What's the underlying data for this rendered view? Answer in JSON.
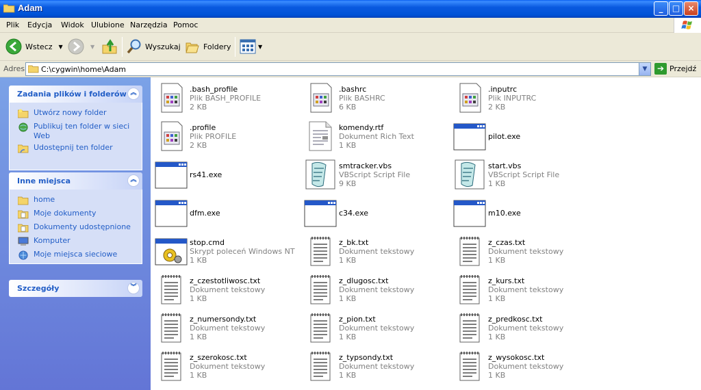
{
  "window": {
    "title": "Adam",
    "min": "_",
    "max": "□",
    "close": "×"
  },
  "menu": [
    "Plik",
    "Edycja",
    "Widok",
    "Ulubione",
    "Narzędzia",
    "Pomoc"
  ],
  "toolbar": {
    "back": "Wstecz",
    "search": "Wyszukaj",
    "folders": "Foldery"
  },
  "address": {
    "label": "Adres",
    "value": "C:\\cygwin\\home\\Adam",
    "go": "Przejdź"
  },
  "panels": {
    "tasks": {
      "title": "Zadania plików i folderów",
      "items": [
        "Utwórz nowy folder",
        "Publikuj ten folder w sieci Web",
        "Udostępnij ten folder"
      ]
    },
    "places": {
      "title": "Inne miejsca",
      "items": [
        "home",
        "Moje dokumenty",
        "Dokumenty udostępnione",
        "Komputer",
        "Moje miejsca sieciowe"
      ]
    },
    "details": {
      "title": "Szczegóły"
    }
  },
  "files": [
    {
      "name": ".bash_profile",
      "type": "Plik BASH_PROFILE",
      "size": "2 KB",
      "icon": "generic"
    },
    {
      "name": ".bashrc",
      "type": "Plik BASHRC",
      "size": "6 KB",
      "icon": "generic"
    },
    {
      "name": ".inputrc",
      "type": "Plik INPUTRC",
      "size": "2 KB",
      "icon": "generic"
    },
    {
      "name": ".profile",
      "type": "Plik PROFILE",
      "size": "2 KB",
      "icon": "generic"
    },
    {
      "name": "komendy.rtf",
      "type": "Dokument Rich Text",
      "size": "1 KB",
      "icon": "rtf"
    },
    {
      "name": "pilot.exe",
      "type": "",
      "size": "",
      "icon": "exe"
    },
    {
      "name": "rs41.exe",
      "type": "",
      "size": "",
      "icon": "exe"
    },
    {
      "name": "smtracker.vbs",
      "type": "VBScript Script File",
      "size": "9 KB",
      "icon": "vbs"
    },
    {
      "name": "start.vbs",
      "type": "VBScript Script File",
      "size": "1 KB",
      "icon": "vbs"
    },
    {
      "name": "dfm.exe",
      "type": "",
      "size": "",
      "icon": "exe"
    },
    {
      "name": "c34.exe",
      "type": "",
      "size": "",
      "icon": "exe"
    },
    {
      "name": "m10.exe",
      "type": "",
      "size": "",
      "icon": "exe"
    },
    {
      "name": "stop.cmd",
      "type": "Skrypt poleceń Windows NT",
      "size": "1 KB",
      "icon": "cmd"
    },
    {
      "name": "z_bk.txt",
      "type": "Dokument tekstowy",
      "size": "1 KB",
      "icon": "txt"
    },
    {
      "name": "z_czas.txt",
      "type": "Dokument tekstowy",
      "size": "1 KB",
      "icon": "txt"
    },
    {
      "name": "z_czestotliwosc.txt",
      "type": "Dokument tekstowy",
      "size": "1 KB",
      "icon": "txt"
    },
    {
      "name": "z_dlugosc.txt",
      "type": "Dokument tekstowy",
      "size": "1 KB",
      "icon": "txt"
    },
    {
      "name": "z_kurs.txt",
      "type": "Dokument tekstowy",
      "size": "1 KB",
      "icon": "txt"
    },
    {
      "name": "z_numersondy.txt",
      "type": "Dokument tekstowy",
      "size": "1 KB",
      "icon": "txt"
    },
    {
      "name": "z_pion.txt",
      "type": "Dokument tekstowy",
      "size": "1 KB",
      "icon": "txt"
    },
    {
      "name": "z_predkosc.txt",
      "type": "Dokument tekstowy",
      "size": "1 KB",
      "icon": "txt"
    },
    {
      "name": "z_szerokosc.txt",
      "type": "Dokument tekstowy",
      "size": "1 KB",
      "icon": "txt"
    },
    {
      "name": "z_typsondy.txt",
      "type": "Dokument tekstowy",
      "size": "1 KB",
      "icon": "txt"
    },
    {
      "name": "z_wysokosc.txt",
      "type": "Dokument tekstowy",
      "size": "1 KB",
      "icon": "txt"
    }
  ]
}
